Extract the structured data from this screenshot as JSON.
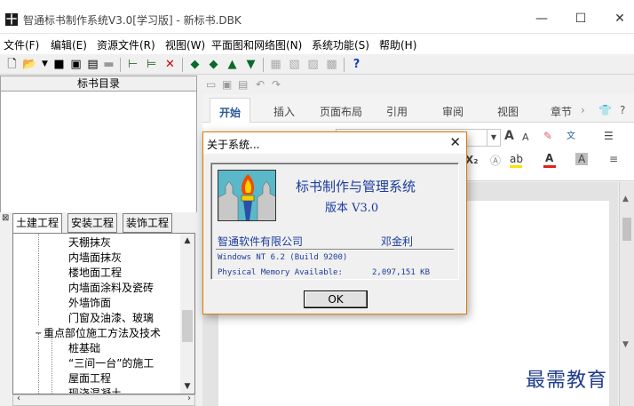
{
  "window": {
    "title": "智通标书制作系统V3.0[学习版] - 新标书.DBK",
    "app_icon": "十",
    "minimize": "—",
    "maximize": "☐",
    "close": "✕"
  },
  "menu": [
    "文件(F)",
    "编辑(E)",
    "资源文件(R)",
    "视图(W)",
    "平面图和网络图(N)",
    "系统功能(S)",
    "帮助(H)"
  ],
  "toolbar": {
    "icons": [
      "new-file-icon",
      "open-folder-icon",
      "dropdown-arrow-icon",
      "save-icon",
      "save-all-icon",
      "properties-icon",
      "bookmark-icon",
      "insert-node-icon",
      "insert-child-icon",
      "delete-icon",
      "arrow-left-icon",
      "arrow-right-icon",
      "arrow-up-icon",
      "arrow-down-icon",
      "print-icon",
      "export-icon",
      "picture-icon",
      "preview-icon",
      "help-icon"
    ]
  },
  "left_panel": {
    "header": "标书目录",
    "tabs": [
      "土建工程",
      "安装工程",
      "装饰工程"
    ],
    "tree_items": [
      {
        "label": "天棚抹灰",
        "level": 2
      },
      {
        "label": "内墙面抹灰",
        "level": 2
      },
      {
        "label": "楼地面工程",
        "level": 2
      },
      {
        "label": "内墙面涂料及瓷砖",
        "level": 2
      },
      {
        "label": "外墙饰面",
        "level": 2
      },
      {
        "label": "门窗及油漆、玻璃",
        "level": 2
      },
      {
        "label": "重点部位施工方法及技术",
        "level": 1,
        "expander": "−"
      },
      {
        "label": "桩基础",
        "level": 2
      },
      {
        "label": "“三间一台”的施工",
        "level": 2
      },
      {
        "label": "屋面工程",
        "level": 2
      },
      {
        "label": "现浇混凝土",
        "level": 2
      }
    ]
  },
  "word": {
    "ribbon_tabs": [
      "开始",
      "插入",
      "页面布局",
      "引用",
      "审阅",
      "视图",
      "章节"
    ],
    "active_tab": "开始",
    "ribbon_more": "›",
    "font_grow": "A",
    "font_shrink": "A",
    "subscript": "X₂",
    "bullets": "☰"
  },
  "dialog": {
    "title": "关于系统...",
    "close": "✕",
    "product_name": "标书制作与管理系统",
    "version": "版本 V3.0",
    "company": "智通软件有限公司",
    "author": "邓金利",
    "os_info": "Windows NT 6.2 (Build 9200)",
    "memory_label": "Physical Memory Available:",
    "memory_value": "2,097,151 KB",
    "ok_label": "OK"
  },
  "watermark": "最需教育",
  "colors": {
    "dialog_border": "#e07a00",
    "dialog_text": "#1a3c9c",
    "ribbon_active": "#2b579a"
  }
}
